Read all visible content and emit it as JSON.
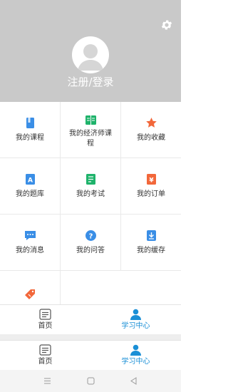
{
  "header": {
    "login_label": "注册/登录"
  },
  "menu": {
    "items": [
      {
        "label": "我的课程",
        "icon": "book-icon",
        "color": "#3a8ee6"
      },
      {
        "label": "我的经济师课程",
        "icon": "open-book-icon",
        "color": "#1fb36b"
      },
      {
        "label": "我的收藏",
        "icon": "star-icon",
        "color": "#f2673a"
      },
      {
        "label": "我的题库",
        "icon": "question-bank-icon",
        "color": "#3a8ee6"
      },
      {
        "label": "我的考试",
        "icon": "exam-icon",
        "color": "#1fb36b"
      },
      {
        "label": "我的订单",
        "icon": "order-icon",
        "color": "#f2673a"
      },
      {
        "label": "我的消息",
        "icon": "message-icon",
        "color": "#3a8ee6"
      },
      {
        "label": "我的问答",
        "icon": "question-icon",
        "color": "#3a8ee6"
      },
      {
        "label": "我的缓存",
        "icon": "download-icon",
        "color": "#3a8ee6"
      },
      {
        "label": "",
        "icon": "tag-icon",
        "color": "#f2673a"
      }
    ]
  },
  "tabbar": {
    "home_label": "首页",
    "learn_label": "学习中心",
    "active_color": "#1a8fd6"
  }
}
